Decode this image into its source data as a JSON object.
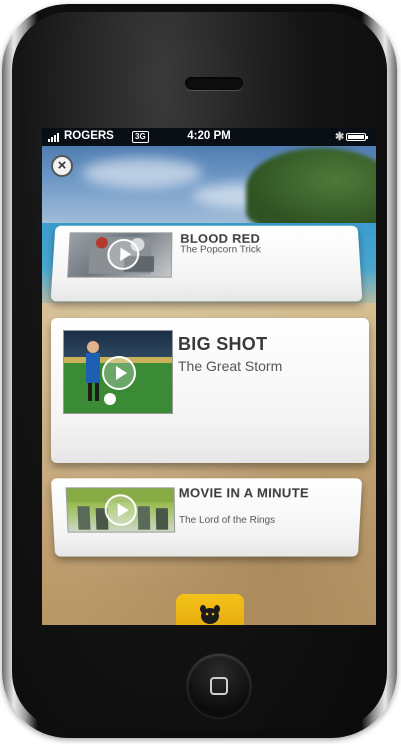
{
  "status_bar": {
    "carrier": "ROGERS",
    "network": "3G",
    "time": "4:20 PM"
  },
  "close_label": "×",
  "cards": [
    {
      "title": "BLOOD RED",
      "subtitle": "The Popcorn Trick"
    },
    {
      "title": "BIG SHOT",
      "subtitle": "The Great Storm"
    },
    {
      "title": "MOVIE IN A MINUTE",
      "subtitle": "The Lord of the Rings"
    }
  ],
  "icons": {
    "close": "close-icon",
    "play": "play-icon",
    "bottom_tab": "dog-icon"
  },
  "colors": {
    "accent": "#f0b90f",
    "card_text": "#3a3a3a"
  }
}
